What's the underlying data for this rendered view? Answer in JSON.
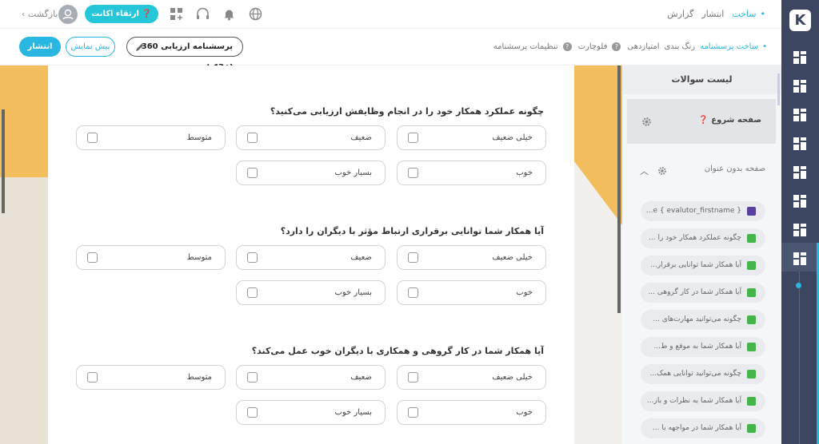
{
  "app": {
    "logo_letter": "K"
  },
  "topbar": {
    "nav": [
      "ساخت",
      "انتشار",
      "گزارش"
    ],
    "active_index": 0,
    "back_label": "بازگشت",
    "upgrade_label": "ارتقاء اکانت"
  },
  "subbar": {
    "tabs": [
      "ساخت پرسشنامه",
      "رنگ بندی",
      "امتیازدهی",
      "فلوچارت",
      "تنظیمات پرسشنامه"
    ],
    "publish_label": "انتشار",
    "preview_label": "پیش نمایش",
    "survey_title": "پرسشنامه ارزیابی 360 درجه ۰"
  },
  "side_panel": {
    "title": "لیست سوالات",
    "start_page_label": "صفحه شروع",
    "untitled_page_label": "صفحه بدون عنوان",
    "items": [
      {
        "label": "{ evalutor_firstname } e...",
        "type": "info"
      },
      {
        "label": "چگونه عملکرد همکار خود را ...",
        "type": "check"
      },
      {
        "label": "آیا همکار شما توانایی برقرار...",
        "type": "check"
      },
      {
        "label": "آیا همکار شما در کار گروهی ...",
        "type": "check"
      },
      {
        "label": "چگونه می‌توانید مهارت‌های ...",
        "type": "check"
      },
      {
        "label": "آیا همکار شما به موقع و ط...",
        "type": "check"
      },
      {
        "label": "چگونه می‌توانید توانایی همک...",
        "type": "check"
      },
      {
        "label": "آیا همکار شما به نظرات و باز...",
        "type": "check"
      },
      {
        "label": "آیا همکار شما در مواجهه با ...",
        "type": "check"
      }
    ]
  },
  "questions": [
    {
      "text": "چگونه عملکرد همکار خود را در انجام وظایفش ارزیابی می‌کنید؟",
      "options": [
        "خیلی ضعیف",
        "ضعیف",
        "متوسط",
        "خوب",
        "بسیار خوب"
      ]
    },
    {
      "text": "آیا همکار شما توانایی برقراری ارتباط مؤثر با دیگران را دارد؟",
      "options": [
        "خیلی ضعیف",
        "ضعیف",
        "متوسط",
        "خوب",
        "بسیار خوب"
      ]
    },
    {
      "text": "آیا همکار شما در کار گروهی و همکاری با دیگران خوب عمل می‌کند؟",
      "options": [
        "خیلی ضعیف",
        "ضعیف",
        "متوسط",
        "خوب",
        "بسیار خوب"
      ]
    }
  ],
  "colors": {
    "accent": "#29b6e0",
    "rail": "#3d4660",
    "deco": "#f2bd5c"
  }
}
